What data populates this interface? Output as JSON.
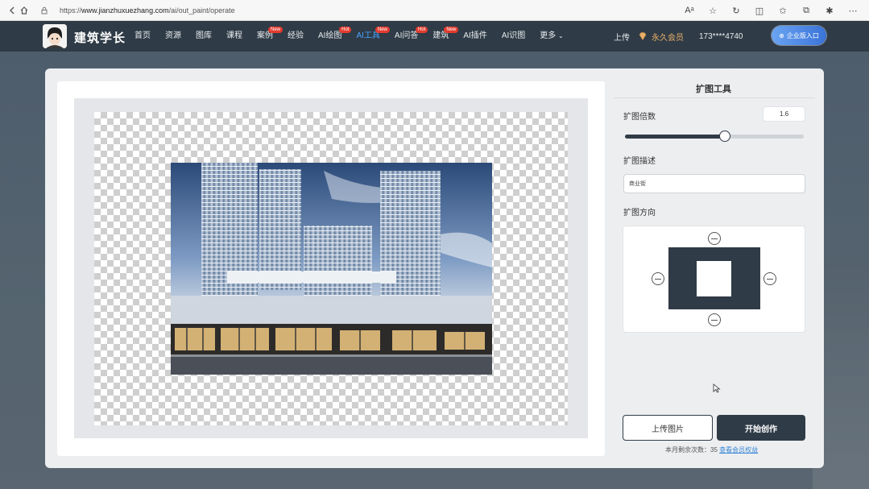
{
  "browser": {
    "url_prefix": "https://",
    "url_domain": "www.jianzhuxuezhang.com",
    "url_path": "/ai/out_paint/operate"
  },
  "site": {
    "logo_text": "建筑学长",
    "nav": [
      {
        "label": "首页"
      },
      {
        "label": "资源"
      },
      {
        "label": "图库"
      },
      {
        "label": "课程"
      },
      {
        "label": "案例",
        "badge": "New"
      },
      {
        "label": "经验"
      },
      {
        "label": "AI绘图",
        "badge": "Hot"
      },
      {
        "label": "AI工具",
        "badge": "New",
        "active": true
      },
      {
        "label": "AI问答",
        "badge": "Hot"
      },
      {
        "label": "建筑",
        "badge": "New"
      },
      {
        "label": "AI插件"
      },
      {
        "label": "AI识图"
      },
      {
        "label": "更多"
      }
    ],
    "upload": "上传",
    "vip": "永久会员",
    "phone": "173****4740",
    "enter_button": "企业版入口"
  },
  "tool": {
    "title": "扩图工具",
    "scale_label": "扩图倍数",
    "scale_value": "1.6",
    "slider_fraction": 0.56,
    "desc_label": "扩图描述",
    "desc_value": "商业街",
    "dir_label": "扩图方向",
    "upload_button": "上传图片",
    "start_button": "开始创作",
    "remain_text": "本月剩余次数：35",
    "remain_link": "查看会员权益"
  },
  "colors": {
    "nav_bg": "#2f3b46",
    "accent": "#4aa3ff",
    "primary_button": "#2f3b46",
    "badge": "#e23b2e"
  }
}
